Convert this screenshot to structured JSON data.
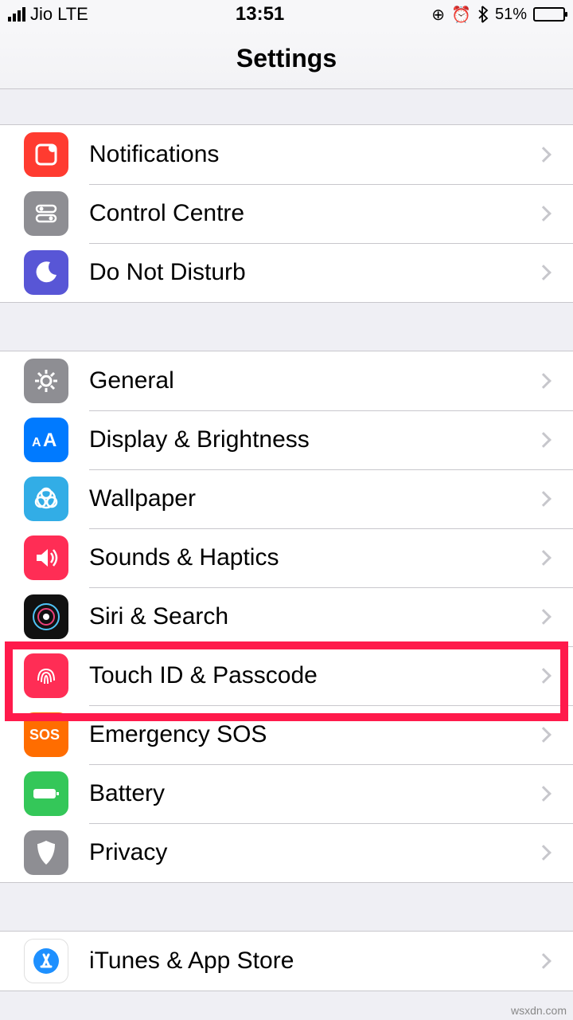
{
  "status": {
    "carrier": "Jio",
    "network": "LTE",
    "time": "13:51",
    "battery_pct": "51%"
  },
  "header": {
    "title": "Settings"
  },
  "group1": [
    {
      "key": "notifications",
      "label": "Notifications"
    },
    {
      "key": "control-centre",
      "label": "Control Centre"
    },
    {
      "key": "dnd",
      "label": "Do Not Disturb"
    }
  ],
  "group2": [
    {
      "key": "general",
      "label": "General"
    },
    {
      "key": "display",
      "label": "Display & Brightness"
    },
    {
      "key": "wallpaper",
      "label": "Wallpaper"
    },
    {
      "key": "sounds",
      "label": "Sounds & Haptics"
    },
    {
      "key": "siri",
      "label": "Siri & Search"
    },
    {
      "key": "touchid",
      "label": "Touch ID & Passcode",
      "highlighted": true
    },
    {
      "key": "sos",
      "label": "Emergency SOS"
    },
    {
      "key": "battery",
      "label": "Battery"
    },
    {
      "key": "privacy",
      "label": "Privacy"
    }
  ],
  "group3": [
    {
      "key": "itunes",
      "label": "iTunes & App Store"
    }
  ],
  "watermark": "wsxdn.com"
}
